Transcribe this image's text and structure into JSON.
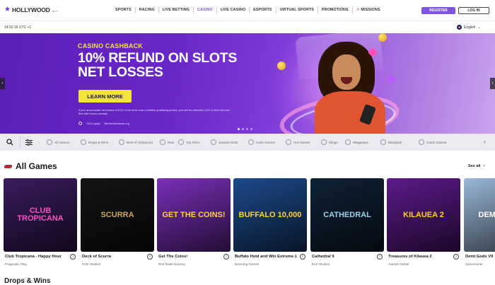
{
  "brand": {
    "name": "HOLLYWOOD",
    "suffix": "BETS"
  },
  "nav": {
    "items": [
      "SPORTS",
      "RACING",
      "LIVE BETTING",
      "CASINO",
      "LIVE CASINO",
      "ESPORTS",
      "VIRTUAL SPORTS",
      "PROMOTIONS",
      "MISSIONS"
    ],
    "active": "CASINO"
  },
  "auth": {
    "register": "REGISTER",
    "login": "LOG IN"
  },
  "clock": "14:22:16 UTC +1",
  "language": "English",
  "hero": {
    "kicker": "CASINO CASHBACK",
    "headline": "10% REFUND ON SLOTS NET LOSSES",
    "cta": "LEARN MORE",
    "fine_print": "If you accumulate net losses of £10+ from slots over a weekly qualifying period, you will be refunded 10% of that net loss. Bet with bonus accepts.",
    "terms": [
      "T&Cs apply",
      "BeGambleAware.org"
    ],
    "slides": 4,
    "active_slide": 1
  },
  "categories": {
    "items": [
      "All Games",
      "Drops & Wins",
      "Best of Hollywood",
      "New",
      "Top Slots",
      "Jackpot Slots",
      "Cash Games",
      "Hot Games",
      "Slingo",
      "Megaways",
      "Blackjack",
      "Cards Games"
    ]
  },
  "all_games": {
    "title": "All Games",
    "see_all": "See all",
    "games": [
      {
        "name": "Club Tropicana - Happy Hour",
        "provider": "Pragmatic Play",
        "art": "CLUB TROPICANA",
        "bg": "#3a1c5e",
        "accent": "#ff4fc3"
      },
      {
        "name": "Deck of Scurra",
        "provider": "Print Studios",
        "art": "SCURRA",
        "bg": "#141414",
        "accent": "#c9a75b"
      },
      {
        "name": "Get The Coins!",
        "provider": "Red Rake Gaming",
        "art": "GET THE COINS!",
        "bg": "#7a2fb8",
        "accent": "#ffd23a"
      },
      {
        "name": "Buffalo Hold and Win Extreme 10,000",
        "provider": "Booming Games",
        "art": "BUFFALO 10,000",
        "bg": "#1c4a8a",
        "accent": "#ffd23a"
      },
      {
        "name": "Cathedral 9",
        "provider": "ELK Studios",
        "art": "CATHEDRAL",
        "bg": "#0f2236",
        "accent": "#9fd1e6"
      },
      {
        "name": "Treasures of Kilauea 2",
        "provider": "Games Global",
        "art": "KILAUEA 2",
        "bg": "#5c1a8a",
        "accent": "#ffcf33"
      },
      {
        "name": "Demi Gods VII",
        "provider": "Spinomenal",
        "art": "DEMI GODS",
        "bg": "#9ab8d8",
        "accent": "#ffffff"
      }
    ]
  },
  "next_section": {
    "title": "Drops & Wins"
  }
}
